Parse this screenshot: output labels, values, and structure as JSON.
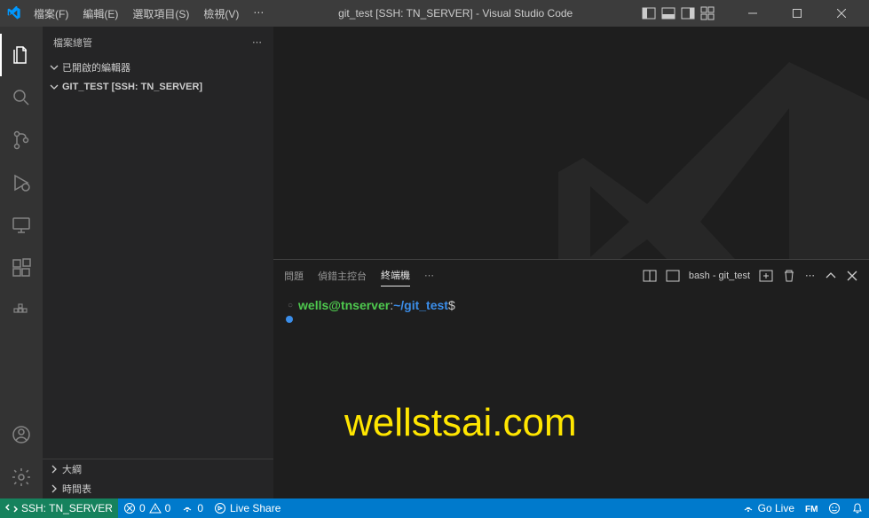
{
  "titlebar": {
    "menus": [
      "檔案(F)",
      "編輯(E)",
      "選取項目(S)",
      "檢視(V)",
      "⋯"
    ],
    "title": "git_test [SSH: TN_SERVER] - Visual Studio Code"
  },
  "sidebar": {
    "header": "檔案總管",
    "sections": {
      "open_editors": "已開啟的編輯器",
      "folder": "GIT_TEST [SSH: TN_SERVER]",
      "outline": "大綱",
      "timeline": "時間表"
    }
  },
  "terminal": {
    "tabs": {
      "problems": "問題",
      "debug": "偵錯主控台",
      "terminal": "終端機"
    },
    "shell_label": "bash - git_test",
    "prompt": {
      "user": "wells@tnserver",
      "sep": ":",
      "path": "~/git_test",
      "dollar": "$"
    },
    "watermark": "wellstsai.com"
  },
  "statusbar": {
    "remote": "SSH: TN_SERVER",
    "errors": "0",
    "warnings": "0",
    "ports": "0",
    "liveshare": "Live Share",
    "golive": "Go Live"
  }
}
